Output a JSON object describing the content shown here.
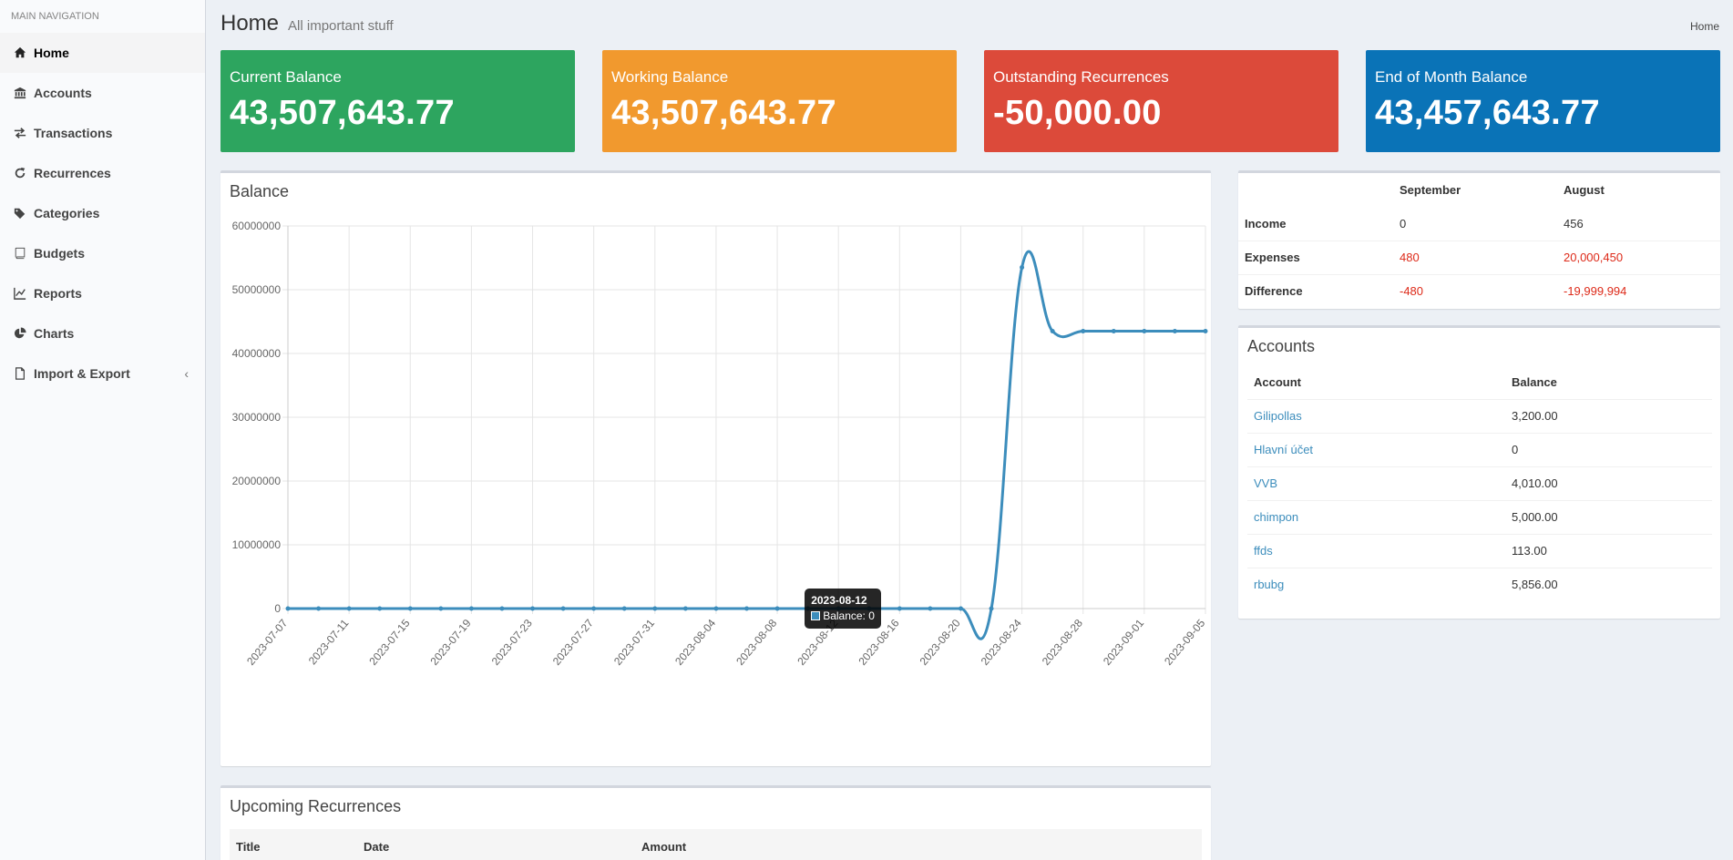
{
  "sidebar": {
    "header": "MAIN NAVIGATION",
    "items": [
      {
        "label": "Home",
        "icon": "home-icon"
      },
      {
        "label": "Accounts",
        "icon": "bank-icon"
      },
      {
        "label": "Transactions",
        "icon": "exchange-icon"
      },
      {
        "label": "Recurrences",
        "icon": "refresh-icon"
      },
      {
        "label": "Categories",
        "icon": "tags-icon"
      },
      {
        "label": "Budgets",
        "icon": "book-icon"
      },
      {
        "label": "Reports",
        "icon": "line-chart-icon"
      },
      {
        "label": "Charts",
        "icon": "pie-chart-icon"
      },
      {
        "label": "Import & Export",
        "icon": "file-icon",
        "chevron": "‹"
      }
    ]
  },
  "header": {
    "title": "Home",
    "subtitle": "All important stuff",
    "breadcrumb": "Home"
  },
  "info_boxes": [
    {
      "label": "Current Balance",
      "value": "43,507,643.77",
      "color": "#2da55f"
    },
    {
      "label": "Working Balance",
      "value": "43,507,643.77",
      "color": "#f1992e"
    },
    {
      "label": "Outstanding Recurrences",
      "value": "-50,000.00",
      "color": "#dc4a3a"
    },
    {
      "label": "End of Month Balance",
      "value": "43,457,643.77",
      "color": "#0a73b7"
    }
  ],
  "balance_chart": {
    "title": "Balance",
    "tooltip": {
      "title": "2023-08-12",
      "label": "Balance: 0"
    }
  },
  "chart_data": {
    "type": "line",
    "title": "Balance",
    "xlabel": "",
    "ylabel": "",
    "ylim": [
      0,
      60000000
    ],
    "yticks": [
      "60000000",
      "50000000",
      "40000000",
      "30000000",
      "20000000",
      "10000000",
      "0"
    ],
    "xticks": [
      "2023-07-07",
      "2023-07-11",
      "2023-07-15",
      "2023-07-19",
      "2023-07-23",
      "2023-07-27",
      "2023-07-31",
      "2023-08-04",
      "2023-08-08",
      "2023-08-12",
      "2023-08-16",
      "2023-08-20",
      "2023-08-24",
      "2023-08-28",
      "2023-09-01",
      "2023-09-05"
    ],
    "grid": true,
    "color": "#3c8dbc",
    "series": [
      {
        "x": [
          "2023-07-07",
          "2023-07-09",
          "2023-07-11",
          "2023-07-13",
          "2023-07-15",
          "2023-07-17",
          "2023-07-19",
          "2023-07-21",
          "2023-07-23",
          "2023-07-25",
          "2023-07-27",
          "2023-07-29",
          "2023-07-31",
          "2023-08-02",
          "2023-08-04",
          "2023-08-06",
          "2023-08-08",
          "2023-08-10",
          "2023-08-12",
          "2023-08-14",
          "2023-08-16",
          "2023-08-18",
          "2023-08-20",
          "2023-08-22",
          "2023-08-24",
          "2023-08-26",
          "2023-08-28",
          "2023-08-30",
          "2023-09-01",
          "2023-09-03",
          "2023-09-05"
        ],
        "values": [
          0,
          0,
          0,
          0,
          0,
          0,
          0,
          0,
          0,
          0,
          0,
          0,
          0,
          0,
          0,
          0,
          0,
          0,
          0,
          0,
          0,
          0,
          0,
          0,
          53500000,
          43500000,
          43500000,
          43500000,
          43500000,
          43500000,
          43500000
        ]
      }
    ]
  },
  "summary": {
    "columns": [
      "",
      "September",
      "August"
    ],
    "rows": [
      {
        "label": "Income",
        "sep": "0",
        "aug": "456",
        "neg": false
      },
      {
        "label": "Expenses",
        "sep": "480",
        "aug": "20,000,450",
        "neg": true
      },
      {
        "label": "Difference",
        "sep": "-480",
        "aug": "-19,999,994",
        "neg": true
      }
    ]
  },
  "accounts": {
    "title": "Accounts",
    "columns": [
      "Account",
      "Balance"
    ],
    "rows": [
      {
        "name": "Gilipollas",
        "balance": "3,200.00"
      },
      {
        "name": "Hlavní účet",
        "balance": "0"
      },
      {
        "name": "VVB",
        "balance": "4,010.00"
      },
      {
        "name": "chimpon",
        "balance": "5,000.00"
      },
      {
        "name": "ffds",
        "balance": "113.00"
      },
      {
        "name": "rbubg",
        "balance": "5,856.00"
      }
    ]
  },
  "recurrences": {
    "title": "Upcoming Recurrences",
    "columns": [
      "Title",
      "Date",
      "Amount"
    ]
  }
}
